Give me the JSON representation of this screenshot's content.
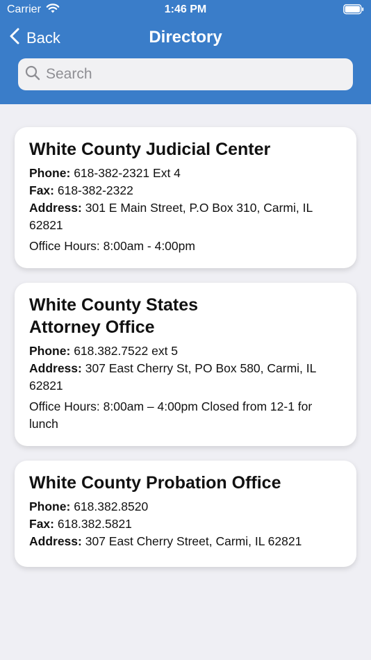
{
  "status_bar": {
    "carrier": "Carrier",
    "time": "1:46 PM"
  },
  "nav": {
    "back_label": "Back",
    "title": "Directory"
  },
  "search": {
    "placeholder": "Search"
  },
  "colors": {
    "header": "#3a7dc9",
    "background": "#efeff4"
  },
  "entries": [
    {
      "name": "White County Judicial Center",
      "phone_label": "Phone:",
      "phone": "618-382-2321 Ext 4",
      "fax_label": "Fax:",
      "fax": "618-382-2322",
      "address_label": "Address:",
      "address": "301 E Main Street, P.O Box 310, Carmi, IL 62821",
      "hours": "Office Hours: 8:00am - 4:00pm"
    },
    {
      "name": "White County States Attorney Office",
      "phone_label": "Phone:",
      "phone": "618.382.7522 ext 5",
      "address_label": "Address:",
      "address": "307 East Cherry St, PO Box 580, Carmi, IL 62821",
      "hours": "Office Hours: 8:00am – 4:00pm Closed from 12-1 for lunch"
    },
    {
      "name": "White County Probation Office",
      "phone_label": "Phone:",
      "phone": "618.382.8520",
      "fax_label": "Fax:",
      "fax": "618.382.5821",
      "address_label": "Address:",
      "address": "307 East Cherry Street, Carmi, IL 62821"
    }
  ]
}
